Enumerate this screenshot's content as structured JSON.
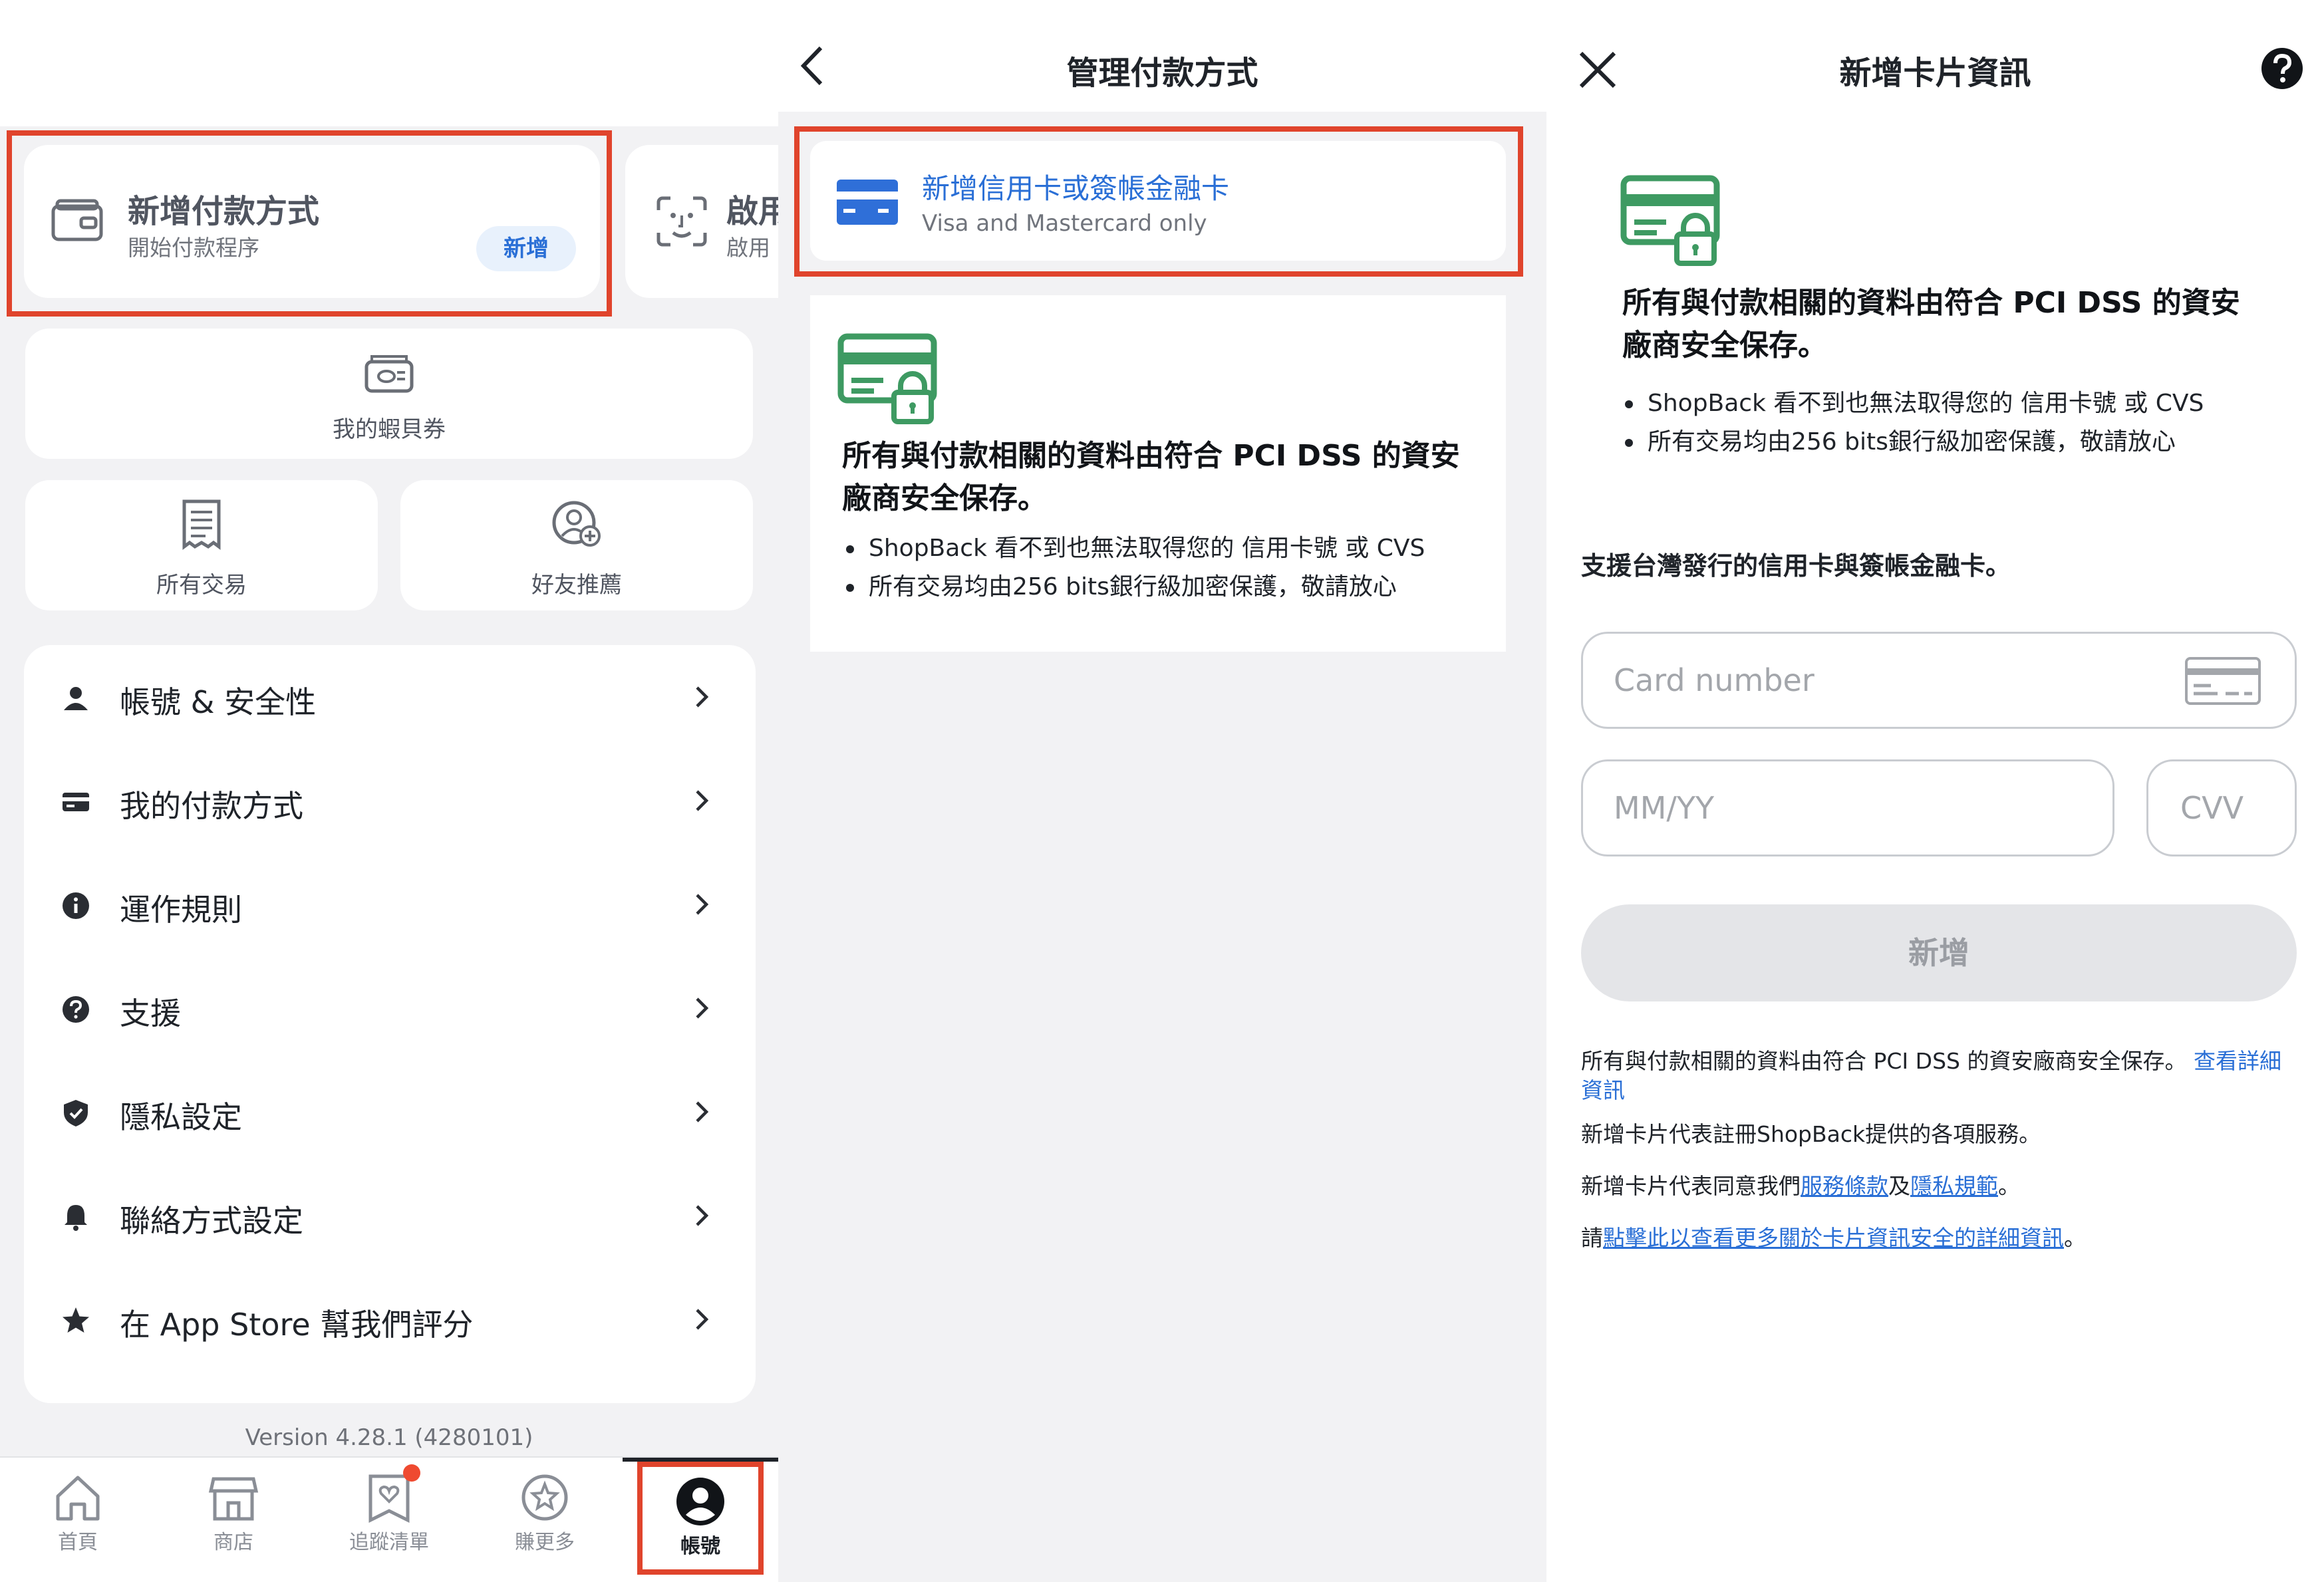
{
  "panel_account": {
    "add_payment": {
      "title": "新增付款方式",
      "subtitle": "開始付款程序",
      "button": "新增"
    },
    "enable_card": {
      "title": "啟用",
      "subtitle": "啟用"
    },
    "voucher": {
      "label": "我的蝦貝券"
    },
    "transactions": {
      "label": "所有交易"
    },
    "referral": {
      "label": "好友推薦"
    },
    "menu": [
      {
        "label": "帳號 & 安全性",
        "icon": "person-icon"
      },
      {
        "label": "我的付款方式",
        "icon": "credit-card-icon"
      },
      {
        "label": "運作規則",
        "icon": "info-icon"
      },
      {
        "label": "支援",
        "icon": "question-icon"
      },
      {
        "label": "隱私設定",
        "icon": "shield-icon"
      },
      {
        "label": "聯絡方式設定",
        "icon": "bell-icon"
      },
      {
        "label": "在 App Store 幫我們評分",
        "icon": "star-icon"
      }
    ],
    "version": "Version 4.28.1 (4280101)",
    "tabs": [
      {
        "label": "首頁",
        "icon": "home-icon"
      },
      {
        "label": "商店",
        "icon": "store-icon"
      },
      {
        "label": "追蹤清單",
        "icon": "heart-list-icon"
      },
      {
        "label": "賺更多",
        "icon": "star-badge-icon"
      },
      {
        "label": "帳號",
        "icon": "account-icon"
      }
    ]
  },
  "panel_manage": {
    "title": "管理付款方式",
    "add_card": {
      "title": "新增信用卡或簽帳金融卡",
      "subtitle": "Visa and Mastercard only"
    },
    "security": {
      "heading": "所有與付款相關的資料由符合 PCI DSS 的資安廠商安全保存。",
      "bullets": [
        "ShopBack 看不到也無法取得您的 信用卡號 或 CVS",
        "所有交易均由256 bits銀行級加密保護，敬請放心"
      ]
    }
  },
  "panel_add_card": {
    "title": "新增卡片資訊",
    "security": {
      "heading": "所有與付款相關的資料由符合 PCI DSS 的資安廠商安全保存。",
      "bullets": [
        "ShopBack 看不到也無法取得您的 信用卡號 或 CVS",
        "所有交易均由256 bits銀行級加密保護，敬請放心"
      ]
    },
    "support_note": "支援台灣發行的信用卡與簽帳金融卡。",
    "card_number_placeholder": "Card number",
    "expiry_placeholder": "MM/YY",
    "cvv_placeholder": "CVV",
    "submit_button": "新增",
    "legal": {
      "line1_text": "所有與付款相關的資料由符合 PCI DSS 的資安廠商安全保存。 ",
      "line1_link": "查看詳細資訊",
      "line2": "新增卡片代表註冊ShopBack提供的各項服務。",
      "line3_prefix": "新增卡片代表同意我們",
      "line3_link1": "服務條款",
      "line3_mid": "及",
      "line3_link2": "隱私規範",
      "line3_suffix": "。",
      "line4_prefix": "請",
      "line4_link": "點擊此以查看更多關於卡片資訊安全的詳細資訊",
      "line4_suffix": "。"
    }
  },
  "colors": {
    "highlight": "#e0442c",
    "link_blue": "#2a6fd6",
    "secure_green": "#3e9a62",
    "badge_red": "#ef4a30"
  }
}
